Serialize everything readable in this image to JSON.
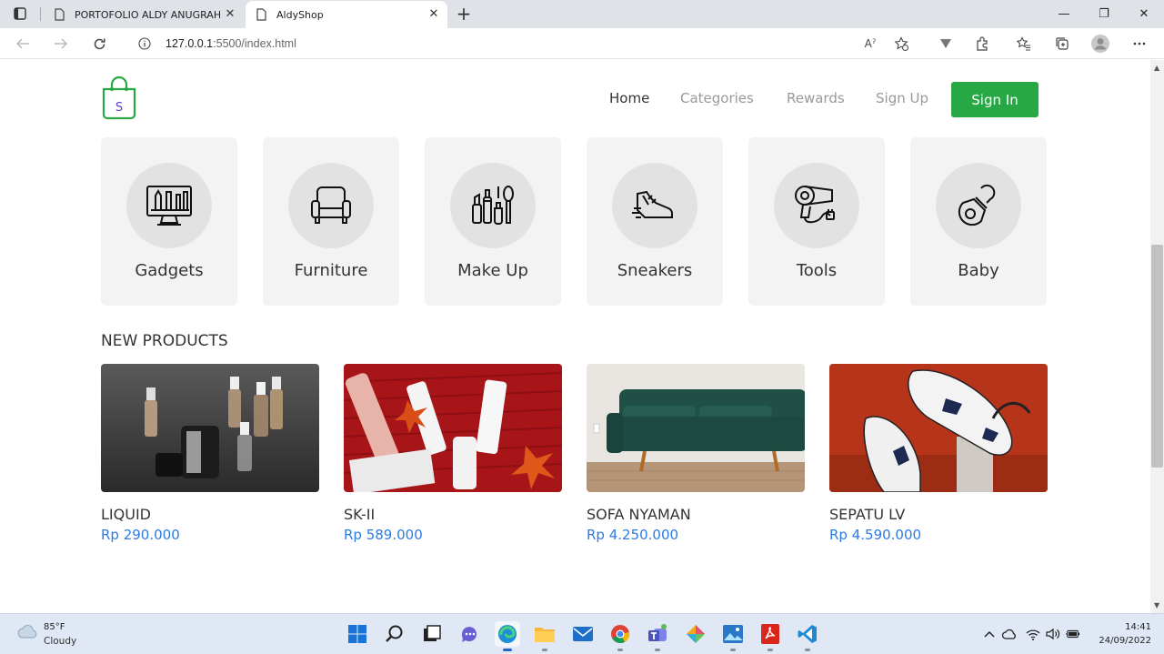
{
  "browser": {
    "tabs": [
      {
        "title": "PORTOFOLIO ALDY ANUGRAH P",
        "close_glyph": "✕"
      },
      {
        "title": "AldyShop",
        "close_glyph": "✕"
      }
    ],
    "new_tab_glyph": "+",
    "window_controls": {
      "minimize": "—",
      "maximize": "❐",
      "close": "✕"
    },
    "url_host": "127.0.0.1",
    "url_rest": ":5500/index.html",
    "reader_icon_label": "Aˀ"
  },
  "site": {
    "logo_letter": "S",
    "brand_color": "#27a844",
    "nav": {
      "home": "Home",
      "categories": "Categories",
      "rewards": "Rewards",
      "signup": "Sign Up",
      "signin": "Sign In"
    },
    "categories": [
      {
        "label": "Gadgets",
        "icon": "monitor-tools-icon"
      },
      {
        "label": "Furniture",
        "icon": "armchair-icon"
      },
      {
        "label": "Make Up",
        "icon": "makeup-icon"
      },
      {
        "label": "Sneakers",
        "icon": "sneaker-icon"
      },
      {
        "label": "Tools",
        "icon": "hair-dryer-icon"
      },
      {
        "label": "Baby",
        "icon": "pacifier-icon"
      }
    ],
    "new_products_title": "NEW PRODUCTS",
    "products": [
      {
        "name": "LIQUID",
        "price": "Rp 290.000"
      },
      {
        "name": "SK-II",
        "price": "Rp 589.000"
      },
      {
        "name": "SOFA NYAMAN",
        "price": "Rp 4.250.000"
      },
      {
        "name": "SEPATU LV",
        "price": "Rp 4.590.000"
      }
    ],
    "price_color": "#2c7be5"
  },
  "taskbar": {
    "temperature": "85°F",
    "condition": "Cloudy",
    "time": "14:41",
    "date": "24/09/2022"
  }
}
